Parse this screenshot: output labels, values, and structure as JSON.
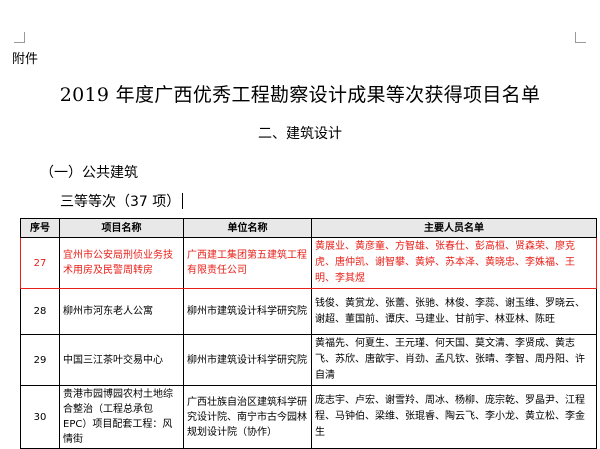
{
  "attachment_label": "附件",
  "title": "2019 年度广西优秀工程勘察设计成果等次获得项目名单",
  "section": "二、建筑设计",
  "subsection": "（一）公共建筑",
  "grade": "三等等次（37 项）",
  "table": {
    "headers": [
      "序号",
      "项目名称",
      "单位名称",
      "主要人员名单"
    ],
    "rows": [
      {
        "no": "27",
        "project": "宜州市公安局刑侦业务技术用房及民警周转房",
        "unit": "广西建工集团第五建筑工程有限责任公司",
        "people": "黄展业、黄彦童、方智雄、张春仕、彭高桓、贤森荣、廖克虎、唐仲凯、谢智攀、黄婷、苏本泽、黄晓忠、李姝福、王明、李其煜"
      },
      {
        "no": "28",
        "project": "柳州市河东老人公寓",
        "unit": "柳州市建筑设计科学研究院",
        "people": "钱俊、黄赏龙、张蕾、张驰、林俊、李蕊、谢玉维、罗晓云、谢超、董国前、谭庆、马建业、甘前宇、林亚林、陈旺"
      },
      {
        "no": "29",
        "project": "中国三江茶叶交易中心",
        "unit": "柳州市建筑设计科学研究院",
        "people": "黄福先、何夏生、王元瑾、何天国、莫文清、李贤成、黄志飞、苏欣、唐歆宇、肖劲、孟凡钦、张晴、李智、周丹阳、许自清"
      },
      {
        "no": "30",
        "project": "贵港市园博园农村土地综合整治（工程总承包 EPC）项目配套工程：风情街",
        "unit": "广西壮族自治区建筑科学研究设计院、南宁市古今园林规划设计院（协作）",
        "people": "庞志宇、卢宏、谢雪羚、周冰、杨柳、庞宗乾、罗晶尹、江程程、马钟伯、梁维、张琨睿、陶云飞、李小龙、黄立松、李金生"
      }
    ]
  }
}
